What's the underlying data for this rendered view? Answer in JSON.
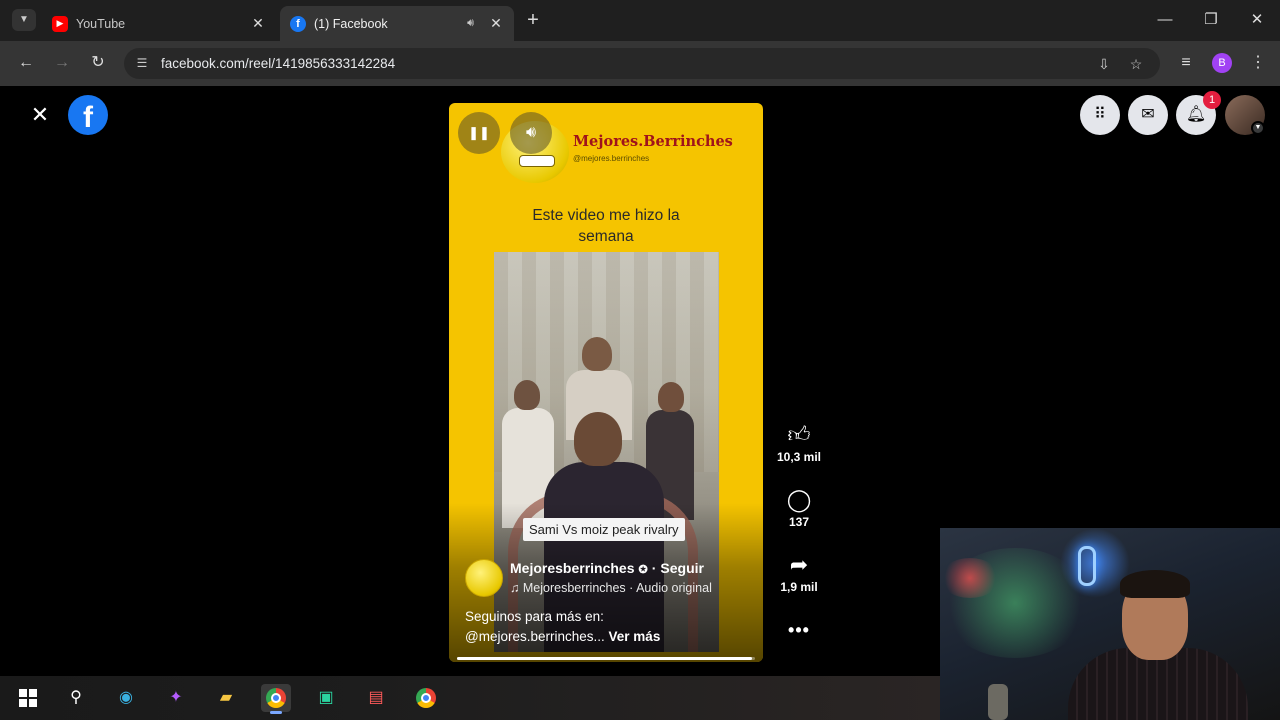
{
  "browser": {
    "tabs": [
      {
        "label": "YouTube",
        "favicon": "youtube-icon",
        "active": false
      },
      {
        "label": "(1) Facebook",
        "favicon": "facebook-icon",
        "active": true,
        "audio": true
      }
    ],
    "url": "facebook.com/reel/1419856333142284",
    "profile_initial": "B"
  },
  "facebook": {
    "logo_letter": "f",
    "notification_count": "1"
  },
  "reel": {
    "channel_name": "Mejores.Berrinches",
    "channel_handle": "@mejores.berrinches",
    "headline": "Este video me hizo la semana",
    "overlay_text": "Sami Vs moiz peak rivalry",
    "author": "Mejoresberrinches",
    "follow_label": "Seguir",
    "audio_line": "Mejoresberrinches · Audio original",
    "caption_line1": "Seguinos para más en:",
    "caption_line2": "@mejores.berrinches...",
    "see_more": "Ver más",
    "progress": 0.99
  },
  "actions": {
    "likes": "10,3 mil",
    "comments": "137",
    "shares": "1,9 mil"
  },
  "colors": {
    "reel_bg": "#f5c400",
    "facebook_blue": "#1877f2",
    "notif_red": "#e41e3f"
  }
}
